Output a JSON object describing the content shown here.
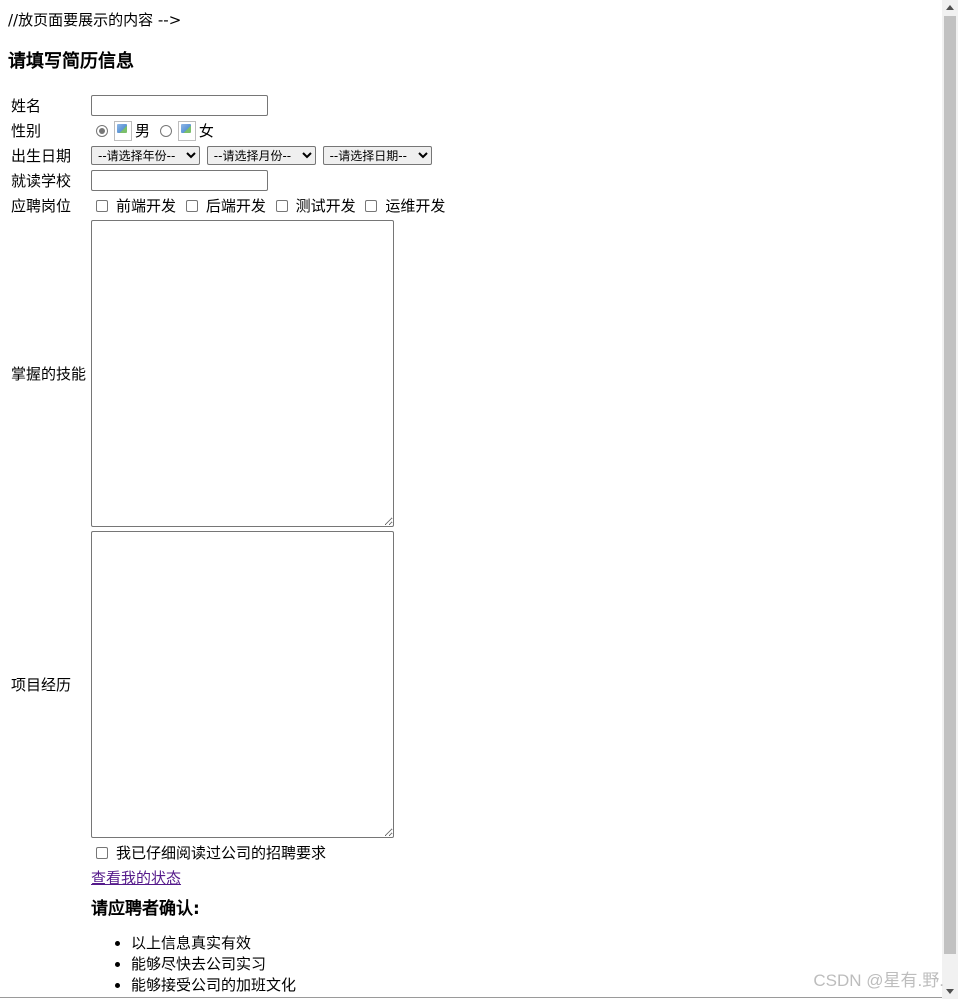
{
  "comment_text": "//放页面要展示的内容 -->",
  "heading": "请填写简历信息",
  "form": {
    "name_label": "姓名",
    "name_value": "",
    "gender_label": "性别",
    "gender_male": "男",
    "gender_female": "女",
    "birth_label": "出生日期",
    "year_select": "--请选择年份--",
    "month_select": "--请选择月份--",
    "day_select": "--请选择日期--",
    "school_label": "就读学校",
    "school_value": "",
    "position_label": "应聘岗位",
    "positions": [
      "前端开发",
      "后端开发",
      "测试开发",
      "运维开发"
    ],
    "skills_label": "掌握的技能",
    "project_label": "项目经历",
    "agree_text": "我已仔细阅读过公司的招聘要求",
    "status_link": "查看我的状态",
    "confirm_heading": "请应聘者确认:",
    "confirm_items": [
      "以上信息真实有效",
      "能够尽快去公司实习",
      "能够接受公司的加班文化"
    ]
  },
  "watermark": "CSDN @星有.野."
}
